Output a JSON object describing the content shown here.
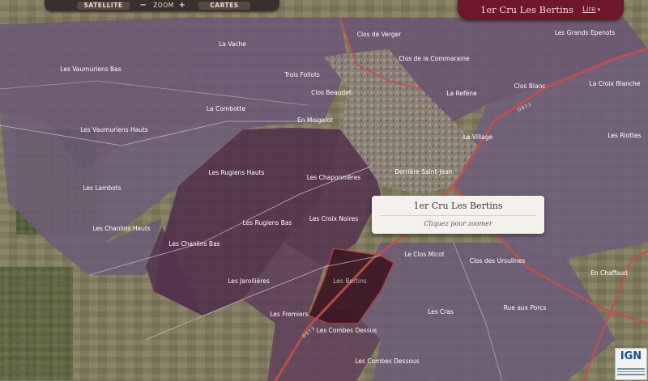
{
  "toolbar": {
    "satellite_label": "SATELLITE",
    "zoom_minus": "−",
    "zoom_label": "ZOOM",
    "zoom_plus": "+",
    "cartes_label": "CARTES"
  },
  "header": {
    "title": "1er Cru Les Bertins",
    "link_label": "Lire",
    "caret": "▾"
  },
  "popup": {
    "title": "1er Cru Les Bertins",
    "subtitle": "Cliquez pour zoomer"
  },
  "logo": {
    "text": "IGN"
  },
  "colors": {
    "parcel": "#5e4660",
    "parcel_dark": "#4a2a3e",
    "selected": "#3b1723",
    "road_red": "#c0504f",
    "header_bg": "#6d1729",
    "toolbar_bg": "#3a2f2c"
  },
  "map": {
    "selected_parcel": "Les Bertins",
    "parcels": [
      "La Vache",
      "Clos de Verger",
      "Les Grands Epenots",
      "Les Vaumuriens Bas",
      "Clos de la Commaraine",
      "Trois Follots",
      "Clos Blanc",
      "La Croix Blanche",
      "Clos Beaudet",
      "La Refène",
      "La Combotte",
      "En Moigelot",
      "Les Vaumuriens Hauts",
      "Le Village",
      "Les Riottes",
      "Les Rugiens Hauts",
      "Les Chaponnières",
      "Derrière Saint-Jean",
      "Les Lambots",
      "Les Rugiens Bas",
      "Les Croix Noires",
      "Les Chanlins Hauts",
      "Les Chanlins Bas",
      "Le Clos Micot",
      "Clos des Ursulines",
      "En Chaffaud",
      "Les Jarollières",
      "Les Bertins",
      "Rue aux Porcs",
      "Les Fremiers",
      "Les Cras",
      "Les Combes Dessus",
      "Les Combes Dessous"
    ]
  }
}
